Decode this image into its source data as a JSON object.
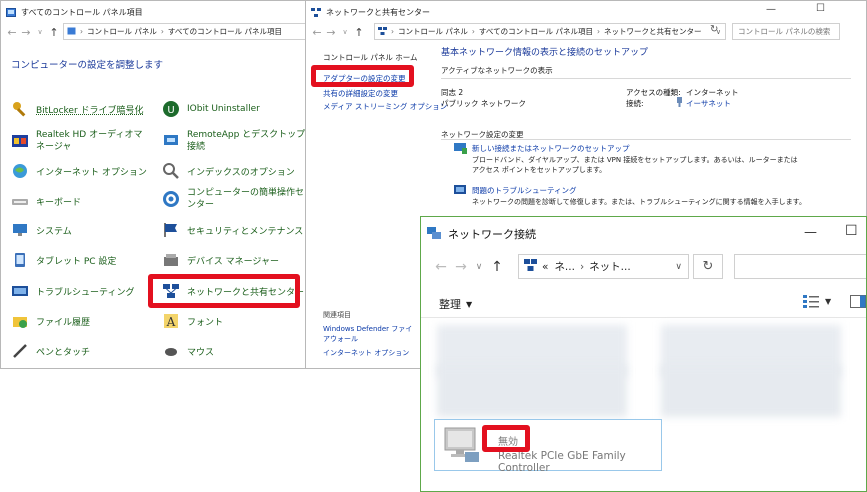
{
  "cp": {
    "title": "すべてのコントロール パネル項目",
    "breadcrumb": [
      "コントロール パネル",
      "すべてのコントロール パネル項目"
    ],
    "heading": "コンピューターの設定を調整します",
    "items_left": [
      {
        "label": "BitLocker ドライブ暗号化",
        "icon": "bitlocker-key-icon"
      },
      {
        "label": "Realtek HD オーディオマネージャ",
        "icon": "realtek-audio-icon"
      },
      {
        "label": "インターネット オプション",
        "icon": "internet-options-icon"
      },
      {
        "label": "キーボード",
        "icon": "keyboard-icon"
      },
      {
        "label": "システム",
        "icon": "system-icon"
      },
      {
        "label": "タブレット PC 設定",
        "icon": "tablet-icon"
      },
      {
        "label": "トラブルシューティング",
        "icon": "troubleshoot-icon"
      },
      {
        "label": "ファイル履歴",
        "icon": "file-history-icon"
      },
      {
        "label": "ペンとタッチ",
        "icon": "pen-icon"
      }
    ],
    "items_right": [
      {
        "label": "IObit Uninstaller",
        "icon": "iobit-icon"
      },
      {
        "label": "RemoteApp とデスクトップ接続",
        "icon": "remoteapp-icon"
      },
      {
        "label": "インデックスのオプション",
        "icon": "indexing-icon"
      },
      {
        "label": "コンピューターの簡単操作センター",
        "icon": "ease-of-access-icon"
      },
      {
        "label": "セキュリティとメンテナンス",
        "icon": "security-flag-icon"
      },
      {
        "label": "デバイス マネージャー",
        "icon": "device-manager-icon"
      },
      {
        "label": "ネットワークと共有センター",
        "icon": "network-center-icon"
      },
      {
        "label": "フォント",
        "icon": "fonts-icon"
      },
      {
        "label": "マウス",
        "icon": "mouse-icon"
      }
    ]
  },
  "nsc": {
    "title": "ネットワークと共有センター",
    "breadcrumb": [
      "コントロール パネル",
      "すべてのコントロール パネル項目",
      "ネットワークと共有センター"
    ],
    "search_placeholder": "コントロール パネルの検索",
    "side_links": [
      "コントロール パネル ホーム",
      "アダプターの設定の変更",
      "共有の詳細設定の変更",
      "メディア ストリーミング オプション"
    ],
    "related_heading": "関連項目",
    "related_links": [
      "Windows Defender ファイアウォール",
      "インターネット オプション"
    ],
    "heading": "基本ネットワーク情報の表示と接続のセットアップ",
    "active_heading": "アクティブなネットワークの表示",
    "network_name": "同志 2",
    "network_type": "パブリック ネットワーク",
    "access_type_label": "アクセスの種類:",
    "access_type_value": "インターネット",
    "connection_label": "接続:",
    "connection_value": "イーサネット",
    "change_heading": "ネットワーク設定の変更",
    "task1_link": "新しい接続またはネットワークのセットアップ",
    "task1_desc": "ブロードバンド、ダイヤルアップ、または VPN 接続をセットアップします。あるいは、ルーターまたはアクセス ポイントをセットアップします。",
    "task2_link": "問題のトラブルシューティング",
    "task2_desc": "ネットワークの問題を診断して修復します。または、トラブルシューティングに関する情報を入手します。"
  },
  "nc": {
    "title": "ネットワーク接続",
    "breadcrumb": [
      "«",
      "ネ...",
      "ネット..."
    ],
    "organize_label": "整理",
    "adapter_status": "無効",
    "adapter_name": "Realtek PCIe GbE Family Controller"
  },
  "colors": {
    "highlight": "#e3101f",
    "link": "#0b3aa8",
    "cp_text": "#1a5e1a"
  }
}
